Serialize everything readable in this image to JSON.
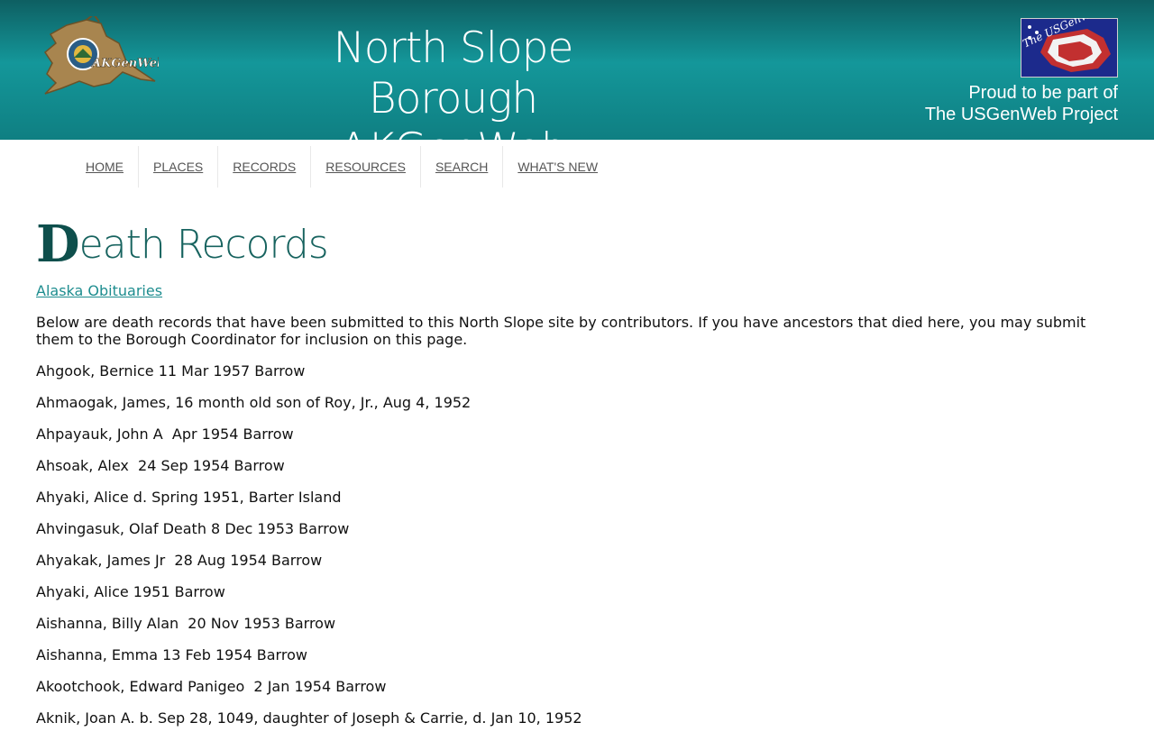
{
  "header": {
    "title_line1": "North Slope Borough",
    "title_line2": "AKGenWeb",
    "logo_left_text": "AKGenWeb",
    "logo_right_text": "The USGenWeb Project",
    "proud_line1": "Proud to be part of",
    "proud_line2": "The USGenWeb Project"
  },
  "nav": {
    "items": [
      {
        "label": "HOME"
      },
      {
        "label": "PLACES"
      },
      {
        "label": "RECORDS"
      },
      {
        "label": "RESOURCES"
      },
      {
        "label": "SEARCH"
      },
      {
        "label": "WHAT'S NEW"
      }
    ]
  },
  "page": {
    "title_initial": "D",
    "title_rest": "eath Records",
    "obituaries_link": "Alaska Obituaries",
    "intro": "Below are death records that have been submitted to this North Slope site by contributors. If you have ancestors that died here, you may submit them to the Borough Coordinator for inclusion on this page."
  },
  "records": [
    "Ahgook, Bernice 11 Mar 1957 Barrow",
    "Ahmaogak, James, 16 month old son of Roy, Jr., Aug 4, 1952",
    "Ahpayauk, John A  Apr 1954 Barrow",
    "Ahsoak, Alex  24 Sep 1954 Barrow",
    "Ahyaki, Alice d. Spring 1951, Barter Island",
    "Ahvingasuk, Olaf Death 8 Dec 1953 Barrow",
    "Ahyakak, James Jr  28 Aug 1954 Barrow",
    "Ahyaki, Alice 1951 Barrow",
    "Aishanna, Billy Alan  20 Nov 1953 Barrow",
    "Aishanna, Emma 13 Feb 1954 Barrow",
    "Akootchook, Edward Panigeo  2 Jan 1954 Barrow",
    "Aknik, Joan A. b. Sep 28, 1049, daughter of Joseph & Carrie, d. Jan 10, 1952"
  ],
  "colors": {
    "header_teal": "#14979a",
    "title_teal": "#17635f",
    "link_teal": "#1e8d8f"
  }
}
